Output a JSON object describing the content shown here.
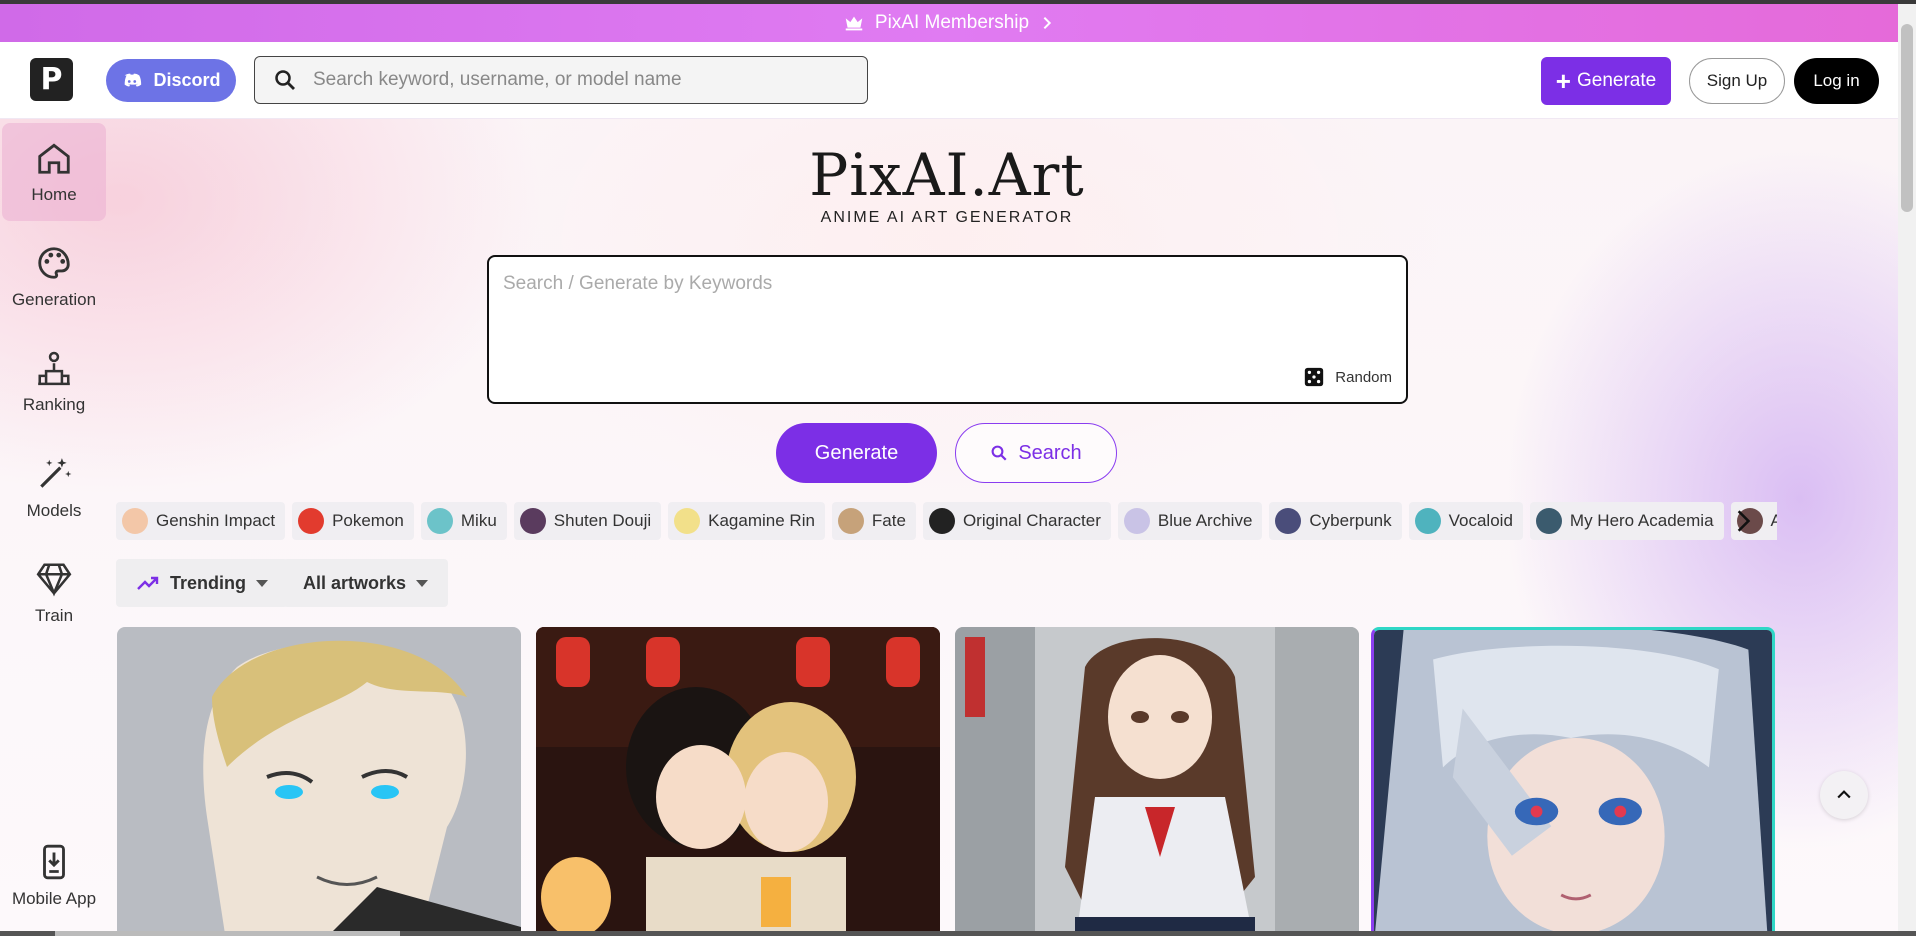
{
  "banner": {
    "text": "PixAI Membership"
  },
  "header": {
    "logo": "P",
    "discord_label": "Discord",
    "search_placeholder": "Search keyword, username, or model name",
    "generate_label": "Generate",
    "signup_label": "Sign Up",
    "login_label": "Log in"
  },
  "sidebar": {
    "items": [
      {
        "label": "Home",
        "icon": "home-icon"
      },
      {
        "label": "Generation",
        "icon": "palette-icon"
      },
      {
        "label": "Ranking",
        "icon": "ranking-icon"
      },
      {
        "label": "Models",
        "icon": "magic-wand-icon"
      },
      {
        "label": "Train",
        "icon": "diamond-icon"
      },
      {
        "label": "Mobile App",
        "icon": "mobile-download-icon"
      }
    ],
    "active": "Home"
  },
  "hero": {
    "title": "PixAI.Art",
    "subtitle": "ANIME AI ART GENERATOR",
    "search_placeholder": "Search / Generate by Keywords",
    "random_label": "Random",
    "generate_label": "Generate",
    "search_label": "Search"
  },
  "tags": [
    {
      "label": "Genshin Impact",
      "color": "#f3c7a8"
    },
    {
      "label": "Pokemon",
      "color": "#e23b2e"
    },
    {
      "label": "Miku",
      "color": "#6cc3c9"
    },
    {
      "label": "Shuten Douji",
      "color": "#5a3b5e"
    },
    {
      "label": "Kagamine Rin",
      "color": "#f2e08a"
    },
    {
      "label": "Fate",
      "color": "#c6a27a"
    },
    {
      "label": "Original Character",
      "color": "#222222"
    },
    {
      "label": "Blue Archive",
      "color": "#c9c3e6"
    },
    {
      "label": "Cyberpunk",
      "color": "#4a4d7a"
    },
    {
      "label": "Vocaloid",
      "color": "#4fb3be"
    },
    {
      "label": "My Hero Academia",
      "color": "#3b5b6e"
    },
    {
      "label": "Attack On Titan",
      "color": "#6b4a4a"
    }
  ],
  "filters": {
    "sort_label": "Trending",
    "type_label": "All artworks"
  },
  "artworks": [
    {
      "name": "blonde-man-blue-eyes"
    },
    {
      "name": "two-girls-lanterns"
    },
    {
      "name": "schoolgirl-street"
    },
    {
      "name": "silver-hair-girl-red-eyes"
    }
  ],
  "colors": {
    "accent": "#7c2fe6",
    "discord": "#6d73e6",
    "banner": "#dd72ee"
  }
}
